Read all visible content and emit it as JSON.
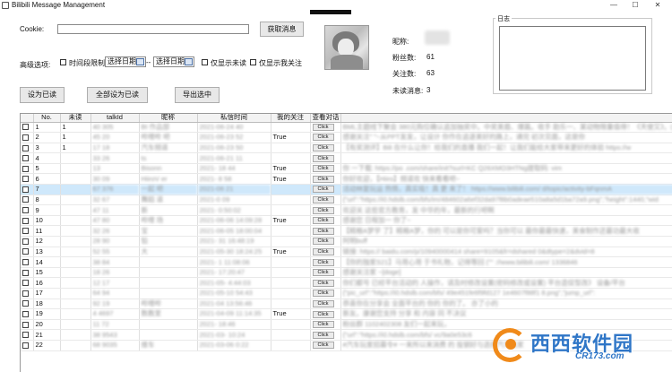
{
  "window": {
    "title": "Bilibili Message Management"
  },
  "cookie": {
    "label": "Cookie:",
    "value": ""
  },
  "buttons": {
    "fetch": "获取消息",
    "set_read": "设为已读",
    "set_all_read": "全部设为已读",
    "export_selected": "导出选中"
  },
  "advanced": {
    "label": "高级选项:",
    "time_limit": "时间段限制",
    "start_date": "选择日期",
    "separator": "--",
    "end_date": "选择日期",
    "only_unread": "仅显示未读",
    "only_following": "仅显示我关注"
  },
  "profile": {
    "name_label": "昵称:",
    "fans_label": "粉丝数:",
    "fans_value": "61",
    "following_label": "关注数:",
    "following_value": "63",
    "unread_label": "未读消息:",
    "unread_value": "3"
  },
  "log": {
    "title": "日志"
  },
  "table": {
    "columns": [
      "",
      "No.",
      "未读",
      "talkId",
      "昵称",
      "私信时间",
      "我的关注",
      "查看对话",
      ""
    ],
    "click_label": "Click",
    "rows": [
      {
        "no": "1",
        "unread": "1",
        "talkid": "40   305",
        "nick": "BI   作品部",
        "time": "2021-06-24   40",
        "follow": "",
        "msg": "BML主题线下聚会 380元购位确认追加抽奖中。中奖美眉、爆篇。收手 助乐一、某动物限量值得！《天使又》。(",
        "blur_talk": true
      },
      {
        "no": "2",
        "unread": "1",
        "talkid": "45   20",
        "nick": "哔哩哔   吧",
        "time": "2021-06-23   52",
        "follow": "True",
        "msg": "感谢关注\"   \"~从PPT发发，让设计    你作在追逐美好的路上，通完     初次见面，这是你",
        "blur_talk": true
      },
      {
        "no": "3",
        "unread": "1",
        "talkid": "17   18",
        "nick": "汽车频道",
        "time": "2021-06-23   50",
        "follow": "",
        "msg": "【有奖测评】Bili   在什么让你！给我们的直播   我们一起！让我们能给大家带来更好的体验   https://w",
        "blur_talk": true
      },
      {
        "no": "4",
        "unread": "",
        "talkid": "33   26",
        "nick": "   ts",
        "time": "2021-06-21   11",
        "follow": "",
        "msg": "",
        "blur_talk": true
      },
      {
        "no": "5",
        "unread": "",
        "talkid": "13   ",
        "nick": "Bisonn   ",
        "time": "2021-    18   44",
        "follow": "True",
        "msg": "你    一下载: https://po   .com/share/init?surl=KC   Q26XMO3HTNg提取码: vim",
        "blur_talk": true
      },
      {
        "no": "6",
        "unread": "",
        "talkid": "30   09",
        "nick": "HiiroV   er",
        "time": "2021-    8   58",
        "follow": "True",
        "msg": "你好欢迎，【Hiiro】频道欢   快来看看吧~",
        "blur_talk": true
      },
      {
        "no": "7",
        "unread": "",
        "talkid": "67   376",
        "nick": "一起   吧",
        "time": "2021-06   21",
        "follow": "",
        "msg": "活动林复玩运     热情，真实吸！真   更   来了！ https://www.bilibili.com/   d/topic/activity-bFqnmA",
        "blur_talk": true,
        "selected": true
      },
      {
        "no": "8",
        "unread": "",
        "talkid": "32   67",
        "nick": "舞蹈   道",
        "time": "2021-0   09",
        "follow": "",
        "msg": "{\"url\":\"https://i0.hdslb.com/bfs/im/484602a6ef32da97f8b0adeae510a8a5d1ba72a9.png\",\"height\":1440,\"wid",
        "blur_talk": true
      },
      {
        "no": "9",
        "unread": "",
        "talkid": "47   11",
        "nick": "新   ",
        "time": "2021-   0:50:02",
        "follow": "",
        "msg": "欢迎关   这些官方教育，发   中华的年，最新的行吧啊",
        "blur_talk": true
      },
      {
        "no": "10",
        "unread": "",
        "talkid": "47   80",
        "nick": "哔哩   场",
        "time": "2021-06-06 14:09:28",
        "follow": "True",
        "msg": "感谢您   日程加一   你了~",
        "blur_talk": true
      },
      {
        "no": "11",
        "unread": "",
        "talkid": "32   26",
        "nick": "   宝",
        "time": "2021-06-05 18:00:04",
        "follow": "",
        "msg": "【精粮A梦学   了】精粮A梦，你的   可以是你可爱吗？当你可以   最你最最快速，美食制作还最功最大收",
        "blur_talk": true
      },
      {
        "no": "12",
        "unread": "",
        "talkid": "28   90",
        "nick": "铅   ",
        "time": "2021-   31 16:48:19",
        "follow": "",
        "msg": "阿明buff",
        "blur_talk": true
      },
      {
        "no": "13",
        "unread": "",
        "talkid": "52   55",
        "nick": "大   ",
        "time": "2021-05-30 18:24:25",
        "follow": "True",
        "msg": "链接: https://   baidu.com/p/10940000414  share=9105&fr=dshared   0&dtype=2&dvid=8",
        "blur_talk": true
      },
      {
        "no": "14",
        "unread": "",
        "talkid": "38   84",
        "nick": "   ",
        "time": "2021-   1 11:08:06",
        "follow": "",
        "msg": "【你的独家S21】马哥心哥   于书礼物，记得等回   (\"\"   ://www.bilibili.com/   1336846",
        "blur_talk": true
      },
      {
        "no": "15",
        "unread": "",
        "talkid": "18   26",
        "nick": "   ",
        "time": "2021-   17:20:47",
        "follow": "",
        "msg": "感谢关注家   ~[doge]",
        "blur_talk": true
      },
      {
        "no": "16",
        "unread": "",
        "talkid": "12   17",
        "nick": "   ",
        "time": "2021-05-   4:44:03",
        "follow": "",
        "msg": "你们都号   已经平台活动的   人操作，请及时修改设置(密码修改或设置)   平台造促型改》 设备/平台",
        "blur_talk": true
      },
      {
        "no": "17",
        "unread": "",
        "talkid": "64   94",
        "nick": "   ",
        "time": "2021-05-10   54:43",
        "follow": "",
        "msg": "{\"pic_url\":\"https://i0.hdslb.com/bfs/   49e451fe6f9fd127   1e4607f88f1   8.png\",\"jump_url\":",
        "blur_talk": true
      },
      {
        "no": "18",
        "unread": "",
        "talkid": "92   19",
        "nick": "哔哩哔   ",
        "time": "2021-04   13:56:46",
        "follow": "",
        "msg": "恭喜你在分享会   全面平台的   你的   你的了。   亦了小的",
        "blur_talk": true
      },
      {
        "no": "19",
        "unread": "",
        "talkid": "4   4697",
        "nick": "   数教室",
        "time": "2021-04-09 11:14:35",
        "follow": "True",
        "msg": "新友。康谢您支持   分享 和   内容   同   不决议   ",
        "blur_talk": true
      },
      {
        "no": "20",
        "unread": "",
        "talkid": "11   72",
        "nick": "   ",
        "time": "2021-   18:46",
        "follow": "",
        "msg": "粉丝群 1102402308   友们一起来玩，   ",
        "blur_talk": true
      },
      {
        "no": "21",
        "unread": "",
        "talkid": "38   9543",
        "nick": "   ",
        "time": "2021-03-   10:24",
        "follow": "",
        "msg": "{\"url\":\"https://i0.hdslb.com/bfs/   vc/9a0e53c6   ",
        "blur_talk": true
      },
      {
        "no": "22",
        "unread": "",
        "talkid": "68   9035",
        "nick": "维车   ",
        "time": "2021-03-06   0:22",
        "follow": "",
        "msg": "#汽车玩家招募令#   一来所以来消费   的   投钢好与选择汽车玩家   ",
        "blur_talk": true
      }
    ]
  },
  "watermark": {
    "text": "西西软件园",
    "sub": "CR173.com"
  }
}
